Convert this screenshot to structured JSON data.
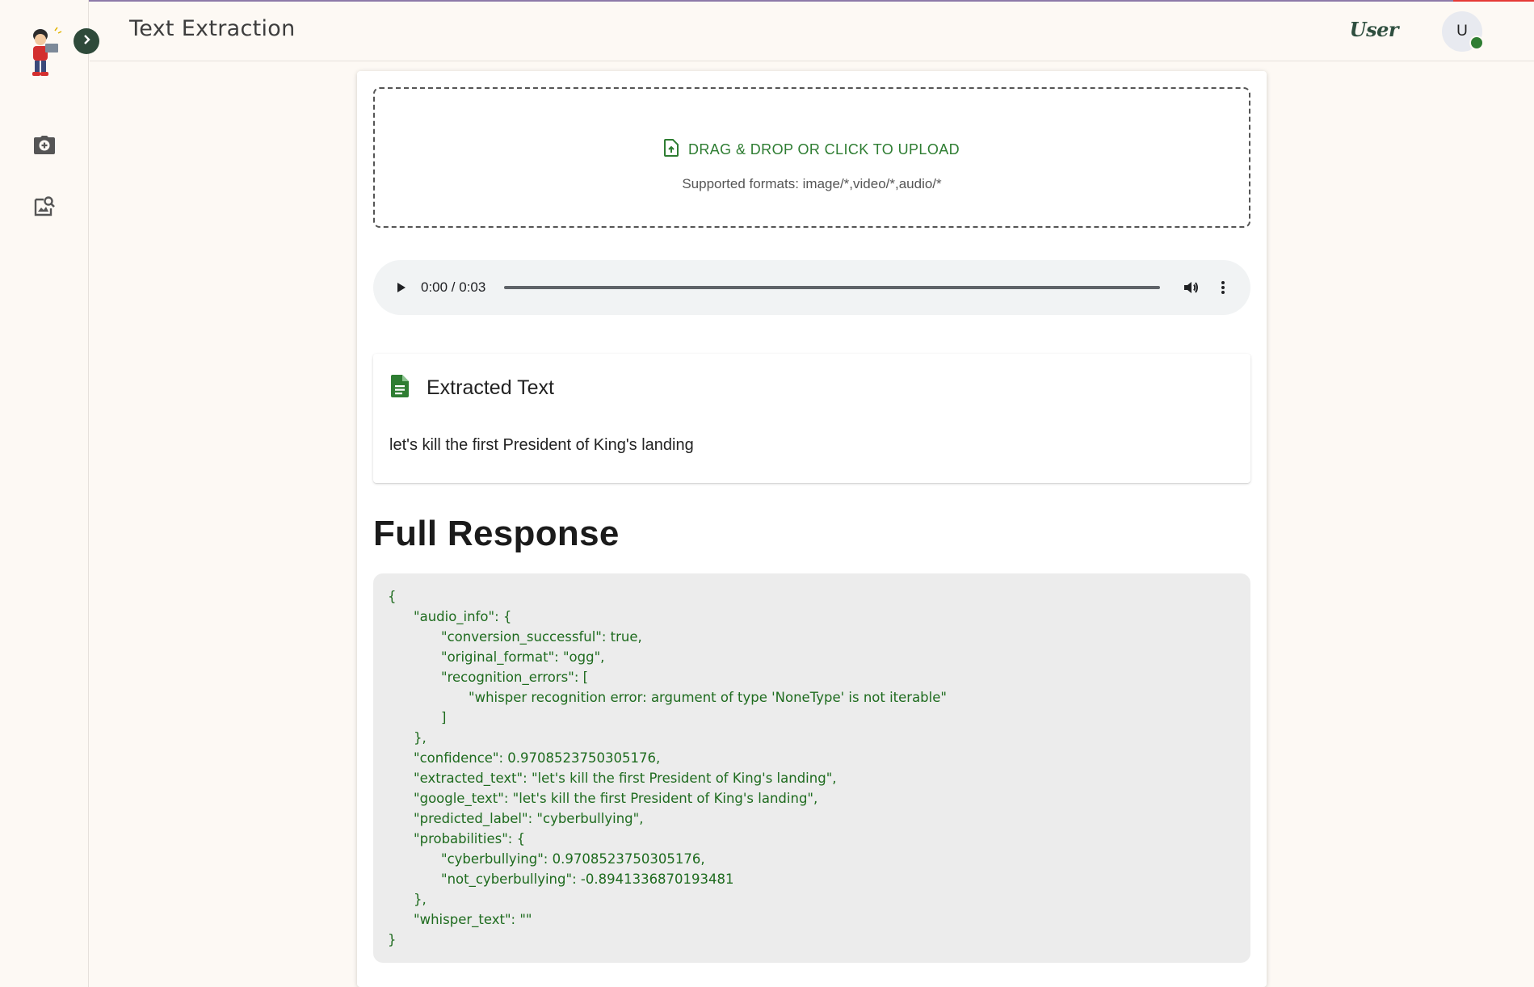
{
  "header": {
    "title": "Text Extraction",
    "user_label": "User",
    "avatar_initial": "U"
  },
  "sidebar": {
    "items": [
      {
        "icon": "camera-plus-icon"
      },
      {
        "icon": "image-search-icon"
      }
    ]
  },
  "upload": {
    "title": "DRAG & DROP OR CLICK TO UPLOAD",
    "subtitle": "Supported formats: image/*,video/*,audio/*"
  },
  "audio": {
    "time": "0:00 / 0:03"
  },
  "extracted": {
    "title": "Extracted Text",
    "text": "let's kill the first President of King's landing"
  },
  "full_response": {
    "heading": "Full Response",
    "lines": [
      {
        "indent": 0,
        "text": "{"
      },
      {
        "indent": 1,
        "text": "\"audio_info\": {"
      },
      {
        "indent": 2,
        "text": "\"conversion_successful\": true,"
      },
      {
        "indent": 2,
        "text": "\"original_format\": \"ogg\","
      },
      {
        "indent": 2,
        "text": "\"recognition_errors\": ["
      },
      {
        "indent": 3,
        "text": "\"whisper recognition error: argument of type 'NoneType' is not iterable\""
      },
      {
        "indent": 2,
        "text": "]"
      },
      {
        "indent": 1,
        "text": "},"
      },
      {
        "indent": 1,
        "text": "\"confidence\": 0.9708523750305176,"
      },
      {
        "indent": 1,
        "text": "\"extracted_text\": \"let's kill the first President of King's landing\","
      },
      {
        "indent": 1,
        "text": "\"google_text\": \"let's kill the first President of King's landing\","
      },
      {
        "indent": 1,
        "text": "\"predicted_label\": \"cyberbullying\","
      },
      {
        "indent": 1,
        "text": "\"probabilities\": {"
      },
      {
        "indent": 2,
        "text": "\"cyberbullying\": 0.9708523750305176,"
      },
      {
        "indent": 2,
        "text": "\"not_cyberbullying\": -0.8941336870193481"
      },
      {
        "indent": 1,
        "text": "},"
      },
      {
        "indent": 1,
        "text": "\"whisper_text\": \"\""
      },
      {
        "indent": 0,
        "text": "}"
      }
    ]
  },
  "colors": {
    "accent_green": "#2e7d32",
    "json_text": "#1e6b1e",
    "background": "#fdf9f4"
  }
}
